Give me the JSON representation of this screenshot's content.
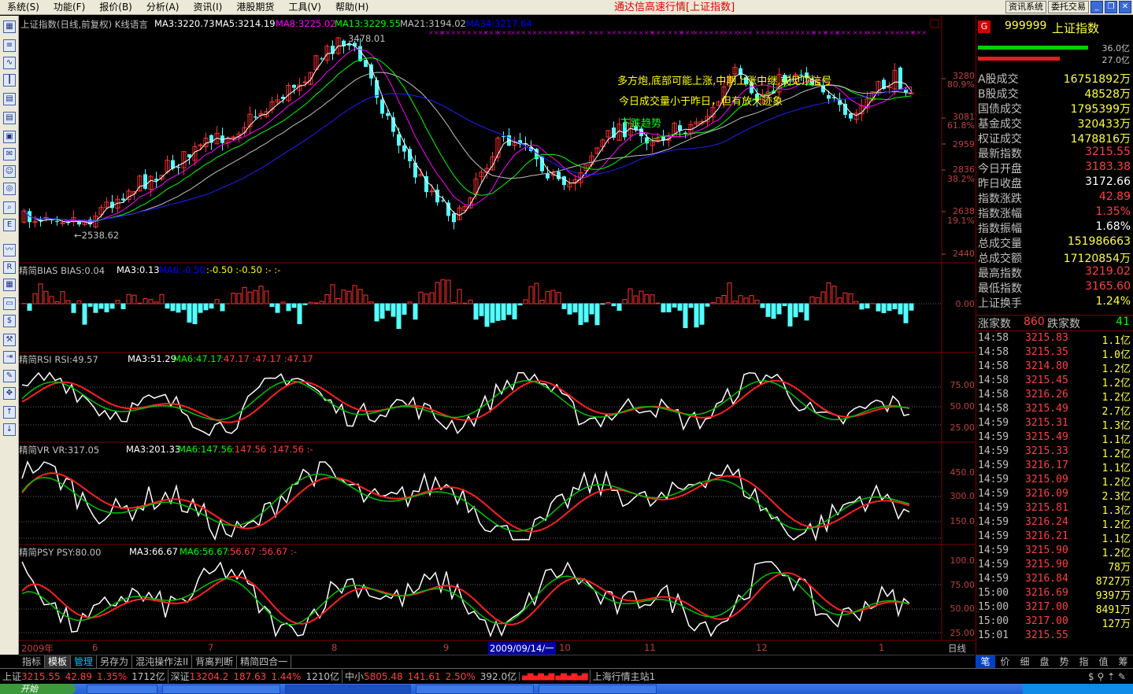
{
  "menu": [
    "系统(S)",
    "功能(F)",
    "报价(B)",
    "分析(A)",
    "资讯(I)",
    "港股期货",
    "工具(V)",
    "帮助(H)"
  ],
  "app_title": "通达信高速行情[上证指数]",
  "top_buttons": [
    "资讯系统",
    "委托交易"
  ],
  "main_panel": {
    "title": "上证指数(日线,前复权) K线语言",
    "ma": [
      {
        "label": "MA3:3220.73",
        "color": "#ffffff"
      },
      {
        "label": "MA5:3214.19",
        "color": "#ffffff"
      },
      {
        "label": "MA8:3225.02",
        "color": "#ff00ff"
      },
      {
        "label": "MA13:3229.55",
        "color": "#00ff00"
      },
      {
        "label": "MA21:3194.02",
        "color": "#c0c0c0"
      },
      {
        "label": "MA34:3217.64",
        "color": "#0000ff"
      }
    ],
    "high_marker": "3478.01",
    "low_marker": "←2538.62",
    "annotations": [
      "多方炮,底部可能上涨,中期上涨中继,或见顶信号",
      "今日成交量小于昨日，但有放大迹象",
      "下跌趋势"
    ],
    "axis": [
      {
        "price": "3280",
        "pct": "80.9%"
      },
      {
        "price": "3081",
        "pct": "61.8%"
      },
      {
        "price": "2959",
        "pct": ""
      },
      {
        "price": "2836",
        "pct": "38.2%"
      },
      {
        "price": "2638",
        "pct": "19.1%"
      },
      {
        "price": "2440",
        "pct": ""
      }
    ]
  },
  "bias_panel": {
    "labels": [
      {
        "text": "精简BIAS  BIAS:0.04",
        "color": "#c0c0c0"
      },
      {
        "text": "MA3:0.13",
        "color": "#ffffff"
      },
      {
        "text": "MA6:-0.50",
        "color": "#0000ff"
      },
      {
        "text": ":-0.50  :-0.50  :-  :-",
        "color": "#ffff00"
      }
    ],
    "axis": [
      "0.00"
    ]
  },
  "rsi_panel": {
    "labels": [
      {
        "text": "精简RSI  RSI:49.57",
        "color": "#c0c0c0"
      },
      {
        "text": "MA3:51.29",
        "color": "#ffffff"
      },
      {
        "text": "MA6:47.17",
        "color": "#00ff00"
      },
      {
        "text": ":47.17  :47.17  :47.17",
        "color": "#ff4040"
      }
    ],
    "axis": [
      "75.00",
      "50.00",
      "25.00"
    ]
  },
  "vr_panel": {
    "labels": [
      {
        "text": "精简VR  VR:317.05",
        "color": "#c0c0c0"
      },
      {
        "text": "MA3:201.33",
        "color": "#ffffff"
      },
      {
        "text": "MA6:147.56",
        "color": "#00ff00"
      },
      {
        "text": ":147.56  :147.56  :-",
        "color": "#ff4040"
      }
    ],
    "axis": [
      "450.0",
      "300.0",
      "150.0"
    ]
  },
  "psy_panel": {
    "labels": [
      {
        "text": "精简PSY  PSY:80.00",
        "color": "#c0c0c0"
      },
      {
        "text": "MA3:66.67",
        "color": "#ffffff"
      },
      {
        "text": "MA6:56.67",
        "color": "#00ff00"
      },
      {
        "text": ":56.67  :56.67  :-",
        "color": "#ff4040"
      }
    ],
    "axis": [
      "100.0",
      "75.00",
      "50.00",
      "25.00"
    ]
  },
  "date_axis": [
    "2009年",
    "6",
    "7",
    "8",
    "9",
    "2009/09/14/一",
    "10",
    "11",
    "12",
    "1"
  ],
  "period_label": "日线",
  "right_panel": {
    "code": "999999",
    "name": "上证指数",
    "vol_top": "36.0亿",
    "vol_bottom": "27.0亿",
    "rows": [
      {
        "label": "A股成交",
        "value": "16751892万",
        "color": "#ffff40"
      },
      {
        "label": "B股成交",
        "value": "48528万",
        "color": "#ffff40"
      },
      {
        "label": "国债成交",
        "value": "1795399万",
        "color": "#ffff40"
      },
      {
        "label": "基金成交",
        "value": "320433万",
        "color": "#ffff40"
      },
      {
        "label": "权证成交",
        "value": "1478816万",
        "color": "#ffff40"
      },
      {
        "label": "最新指数",
        "value": "3215.55",
        "color": "#ff4040"
      },
      {
        "label": "今日开盘",
        "value": "3183.38",
        "color": "#ff4040"
      },
      {
        "label": "昨日收盘",
        "value": "3172.66",
        "color": "#ffffff"
      },
      {
        "label": "指数涨跌",
        "value": "42.89",
        "color": "#ff4040"
      },
      {
        "label": "指数涨幅",
        "value": "1.35%",
        "color": "#ff4040"
      },
      {
        "label": "指数振幅",
        "value": "1.68%",
        "color": "#ffffff"
      },
      {
        "label": "总成交量",
        "value": "151986663",
        "color": "#ffff40"
      },
      {
        "label": "总成交额",
        "value": "17120854万",
        "color": "#ffff40"
      },
      {
        "label": "最高指数",
        "value": "3219.02",
        "color": "#ff4040"
      },
      {
        "label": "最低指数",
        "value": "3165.60",
        "color": "#ff4040"
      },
      {
        "label": "上证换手",
        "value": "1.24%",
        "color": "#ffff40"
      }
    ],
    "up_label": "涨家数",
    "up_value": "860",
    "down_label": "跌家数",
    "down_value": "41",
    "ticks": [
      [
        "14:58",
        "3215.83",
        "1.1亿"
      ],
      [
        "14:58",
        "3215.35",
        "1.0亿"
      ],
      [
        "14:58",
        "3214.80",
        "1.2亿"
      ],
      [
        "14:58",
        "3215.45",
        "1.2亿"
      ],
      [
        "14:58",
        "3216.26",
        "1.2亿"
      ],
      [
        "14:58",
        "3215.49",
        "2.7亿"
      ],
      [
        "14:59",
        "3215.31",
        "1.3亿"
      ],
      [
        "14:59",
        "3215.49",
        "1.1亿"
      ],
      [
        "14:59",
        "3215.33",
        "1.2亿"
      ],
      [
        "14:59",
        "3216.17",
        "1.1亿"
      ],
      [
        "14:59",
        "3215.09",
        "1.2亿"
      ],
      [
        "14:59",
        "3216.09",
        "2.3亿"
      ],
      [
        "14:59",
        "3215.81",
        "1.3亿"
      ],
      [
        "14:59",
        "3216.24",
        "1.2亿"
      ],
      [
        "14:59",
        "3216.21",
        "1.1亿"
      ],
      [
        "14:59",
        "3215.90",
        "1.2亿"
      ],
      [
        "14:59",
        "3215.90",
        "78万"
      ],
      [
        "14:59",
        "3216.84",
        "8727万"
      ],
      [
        "15:00",
        "3216.69",
        "9397万"
      ],
      [
        "15:00",
        "3217.00",
        "8491万"
      ],
      [
        "15:00",
        "3217.00",
        "127万"
      ],
      [
        "15:01",
        "3215.55",
        ""
      ]
    ]
  },
  "bottom_tabs": [
    "指标",
    "模板",
    "管理",
    "另存为",
    "混沌操作法II",
    "背离判断",
    "精简四合一"
  ],
  "right_tabs": [
    "笔",
    "价",
    "细",
    "盘",
    "势",
    "指",
    "值",
    "筹"
  ],
  "status": {
    "sh_label": "上证",
    "sh_price": "3215.55",
    "sh_change": "42.89",
    "sh_pct": "1.35%",
    "sh_amount": "1712亿",
    "sz_label": "深证",
    "sz_price": "13204.2",
    "sz_change": "187.63",
    "sz_pct": "1.44%",
    "sz_amount": "1210亿",
    "zx_label": "中小",
    "zx_price": "5805.48",
    "zx_change": "141.61",
    "zx_pct": "2.50%",
    "zx_amount": "392.0亿",
    "station": "上海行情主站1"
  },
  "taskbar": {
    "start": "开始"
  }
}
